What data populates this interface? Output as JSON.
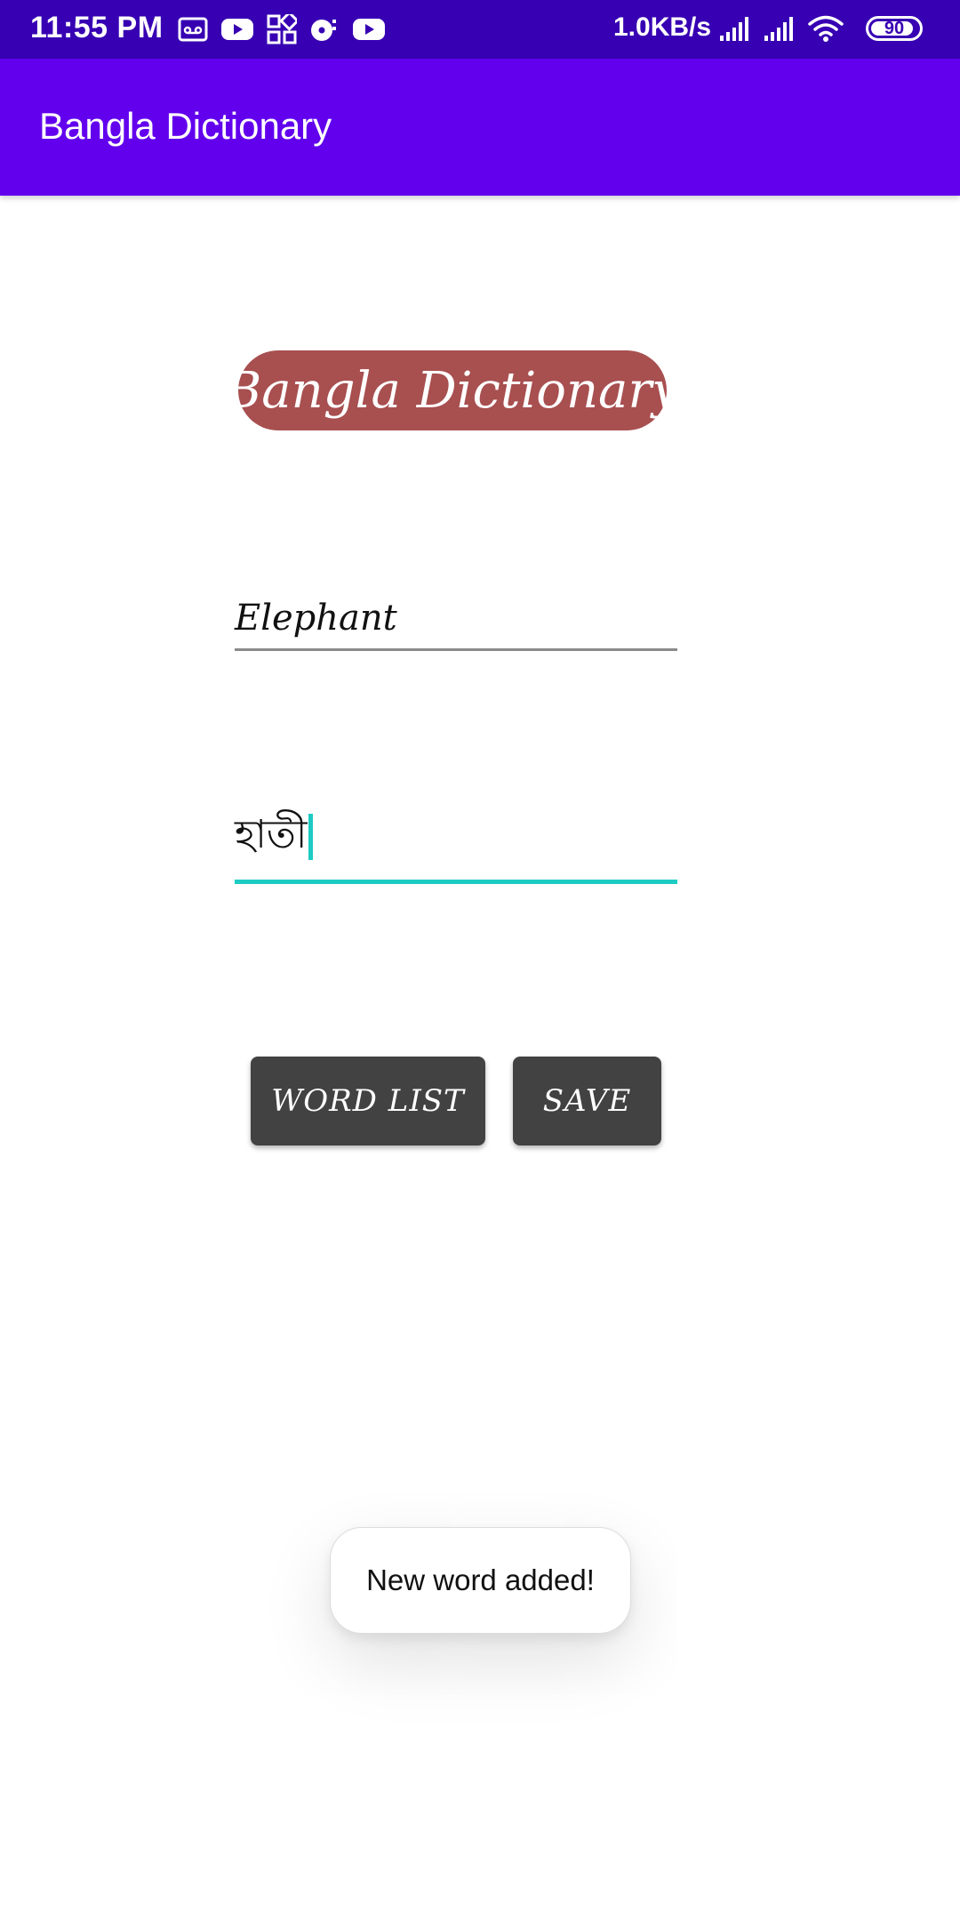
{
  "status_bar": {
    "time": "11:55 PM",
    "network_speed": "1.0KB/s",
    "battery_level": "90",
    "battery_fraction": 0.9,
    "icons_left": [
      "voicemail-icon",
      "youtube-icon",
      "apps-grid-icon",
      "music-icon",
      "youtube-icon"
    ],
    "icons_right": [
      "signal-icon",
      "signal-icon",
      "wifi-icon",
      "battery-icon"
    ]
  },
  "app_bar": {
    "title": "Bangla Dictionary"
  },
  "logo": {
    "text": "Bangla Dictionary",
    "color": "#a84f50"
  },
  "form": {
    "english_word": "Elephant",
    "bangla_meaning": "হাতী"
  },
  "buttons": {
    "word_list": "WORD LIST",
    "save": "SAVE"
  },
  "toast": {
    "message": "New word added!"
  },
  "colors": {
    "status_bar": "#3700b3",
    "app_bar": "#6200ee",
    "accent": "#1ecbc3",
    "button": "#424242"
  }
}
